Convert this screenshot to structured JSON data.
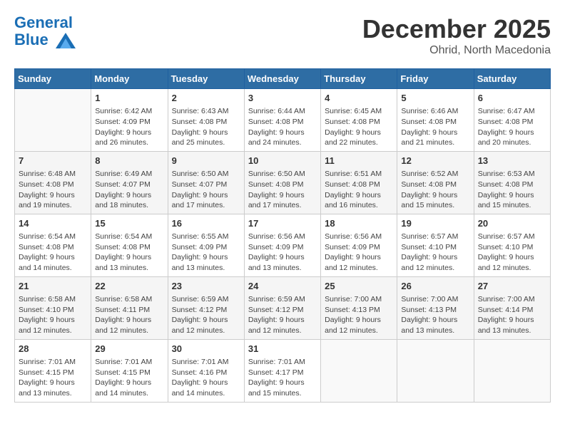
{
  "logo": {
    "line1": "General",
    "line2": "Blue"
  },
  "title": "December 2025",
  "subtitle": "Ohrid, North Macedonia",
  "days_of_week": [
    "Sunday",
    "Monday",
    "Tuesday",
    "Wednesday",
    "Thursday",
    "Friday",
    "Saturday"
  ],
  "weeks": [
    [
      {
        "day": "",
        "info": ""
      },
      {
        "day": "1",
        "info": "Sunrise: 6:42 AM\nSunset: 4:09 PM\nDaylight: 9 hours\nand 26 minutes."
      },
      {
        "day": "2",
        "info": "Sunrise: 6:43 AM\nSunset: 4:08 PM\nDaylight: 9 hours\nand 25 minutes."
      },
      {
        "day": "3",
        "info": "Sunrise: 6:44 AM\nSunset: 4:08 PM\nDaylight: 9 hours\nand 24 minutes."
      },
      {
        "day": "4",
        "info": "Sunrise: 6:45 AM\nSunset: 4:08 PM\nDaylight: 9 hours\nand 22 minutes."
      },
      {
        "day": "5",
        "info": "Sunrise: 6:46 AM\nSunset: 4:08 PM\nDaylight: 9 hours\nand 21 minutes."
      },
      {
        "day": "6",
        "info": "Sunrise: 6:47 AM\nSunset: 4:08 PM\nDaylight: 9 hours\nand 20 minutes."
      }
    ],
    [
      {
        "day": "7",
        "info": "Sunrise: 6:48 AM\nSunset: 4:08 PM\nDaylight: 9 hours\nand 19 minutes."
      },
      {
        "day": "8",
        "info": "Sunrise: 6:49 AM\nSunset: 4:07 PM\nDaylight: 9 hours\nand 18 minutes."
      },
      {
        "day": "9",
        "info": "Sunrise: 6:50 AM\nSunset: 4:07 PM\nDaylight: 9 hours\nand 17 minutes."
      },
      {
        "day": "10",
        "info": "Sunrise: 6:50 AM\nSunset: 4:08 PM\nDaylight: 9 hours\nand 17 minutes."
      },
      {
        "day": "11",
        "info": "Sunrise: 6:51 AM\nSunset: 4:08 PM\nDaylight: 9 hours\nand 16 minutes."
      },
      {
        "day": "12",
        "info": "Sunrise: 6:52 AM\nSunset: 4:08 PM\nDaylight: 9 hours\nand 15 minutes."
      },
      {
        "day": "13",
        "info": "Sunrise: 6:53 AM\nSunset: 4:08 PM\nDaylight: 9 hours\nand 15 minutes."
      }
    ],
    [
      {
        "day": "14",
        "info": "Sunrise: 6:54 AM\nSunset: 4:08 PM\nDaylight: 9 hours\nand 14 minutes."
      },
      {
        "day": "15",
        "info": "Sunrise: 6:54 AM\nSunset: 4:08 PM\nDaylight: 9 hours\nand 13 minutes."
      },
      {
        "day": "16",
        "info": "Sunrise: 6:55 AM\nSunset: 4:09 PM\nDaylight: 9 hours\nand 13 minutes."
      },
      {
        "day": "17",
        "info": "Sunrise: 6:56 AM\nSunset: 4:09 PM\nDaylight: 9 hours\nand 13 minutes."
      },
      {
        "day": "18",
        "info": "Sunrise: 6:56 AM\nSunset: 4:09 PM\nDaylight: 9 hours\nand 12 minutes."
      },
      {
        "day": "19",
        "info": "Sunrise: 6:57 AM\nSunset: 4:10 PM\nDaylight: 9 hours\nand 12 minutes."
      },
      {
        "day": "20",
        "info": "Sunrise: 6:57 AM\nSunset: 4:10 PM\nDaylight: 9 hours\nand 12 minutes."
      }
    ],
    [
      {
        "day": "21",
        "info": "Sunrise: 6:58 AM\nSunset: 4:10 PM\nDaylight: 9 hours\nand 12 minutes."
      },
      {
        "day": "22",
        "info": "Sunrise: 6:58 AM\nSunset: 4:11 PM\nDaylight: 9 hours\nand 12 minutes."
      },
      {
        "day": "23",
        "info": "Sunrise: 6:59 AM\nSunset: 4:12 PM\nDaylight: 9 hours\nand 12 minutes."
      },
      {
        "day": "24",
        "info": "Sunrise: 6:59 AM\nSunset: 4:12 PM\nDaylight: 9 hours\nand 12 minutes."
      },
      {
        "day": "25",
        "info": "Sunrise: 7:00 AM\nSunset: 4:13 PM\nDaylight: 9 hours\nand 12 minutes."
      },
      {
        "day": "26",
        "info": "Sunrise: 7:00 AM\nSunset: 4:13 PM\nDaylight: 9 hours\nand 13 minutes."
      },
      {
        "day": "27",
        "info": "Sunrise: 7:00 AM\nSunset: 4:14 PM\nDaylight: 9 hours\nand 13 minutes."
      }
    ],
    [
      {
        "day": "28",
        "info": "Sunrise: 7:01 AM\nSunset: 4:15 PM\nDaylight: 9 hours\nand 13 minutes."
      },
      {
        "day": "29",
        "info": "Sunrise: 7:01 AM\nSunset: 4:15 PM\nDaylight: 9 hours\nand 14 minutes."
      },
      {
        "day": "30",
        "info": "Sunrise: 7:01 AM\nSunset: 4:16 PM\nDaylight: 9 hours\nand 14 minutes."
      },
      {
        "day": "31",
        "info": "Sunrise: 7:01 AM\nSunset: 4:17 PM\nDaylight: 9 hours\nand 15 minutes."
      },
      {
        "day": "",
        "info": ""
      },
      {
        "day": "",
        "info": ""
      },
      {
        "day": "",
        "info": ""
      }
    ]
  ]
}
